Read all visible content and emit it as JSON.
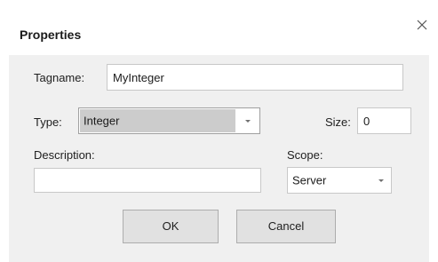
{
  "window": {
    "title": "Properties",
    "close_glyph": "×"
  },
  "form": {
    "tagname_label": "Tagname:",
    "tagname_value": "MyInteger",
    "type_label": "Type:",
    "type_value": "Integer",
    "size_label": "Size:",
    "size_value": "0",
    "description_label": "Description:",
    "description_value": "",
    "scope_label": "Scope:",
    "scope_value": "Server"
  },
  "buttons": {
    "ok_label": "OK",
    "cancel_label": "Cancel"
  },
  "icons": {
    "close": "close-icon",
    "dropdown": "chevron-down-icon"
  },
  "colors": {
    "dialog_background": "#ffffff",
    "panel_background": "#f0f0f0",
    "field_border": "#c8c8c8",
    "selected_combo": "#cccccc",
    "button_face": "#e1e1e1",
    "button_border": "#adadad"
  }
}
